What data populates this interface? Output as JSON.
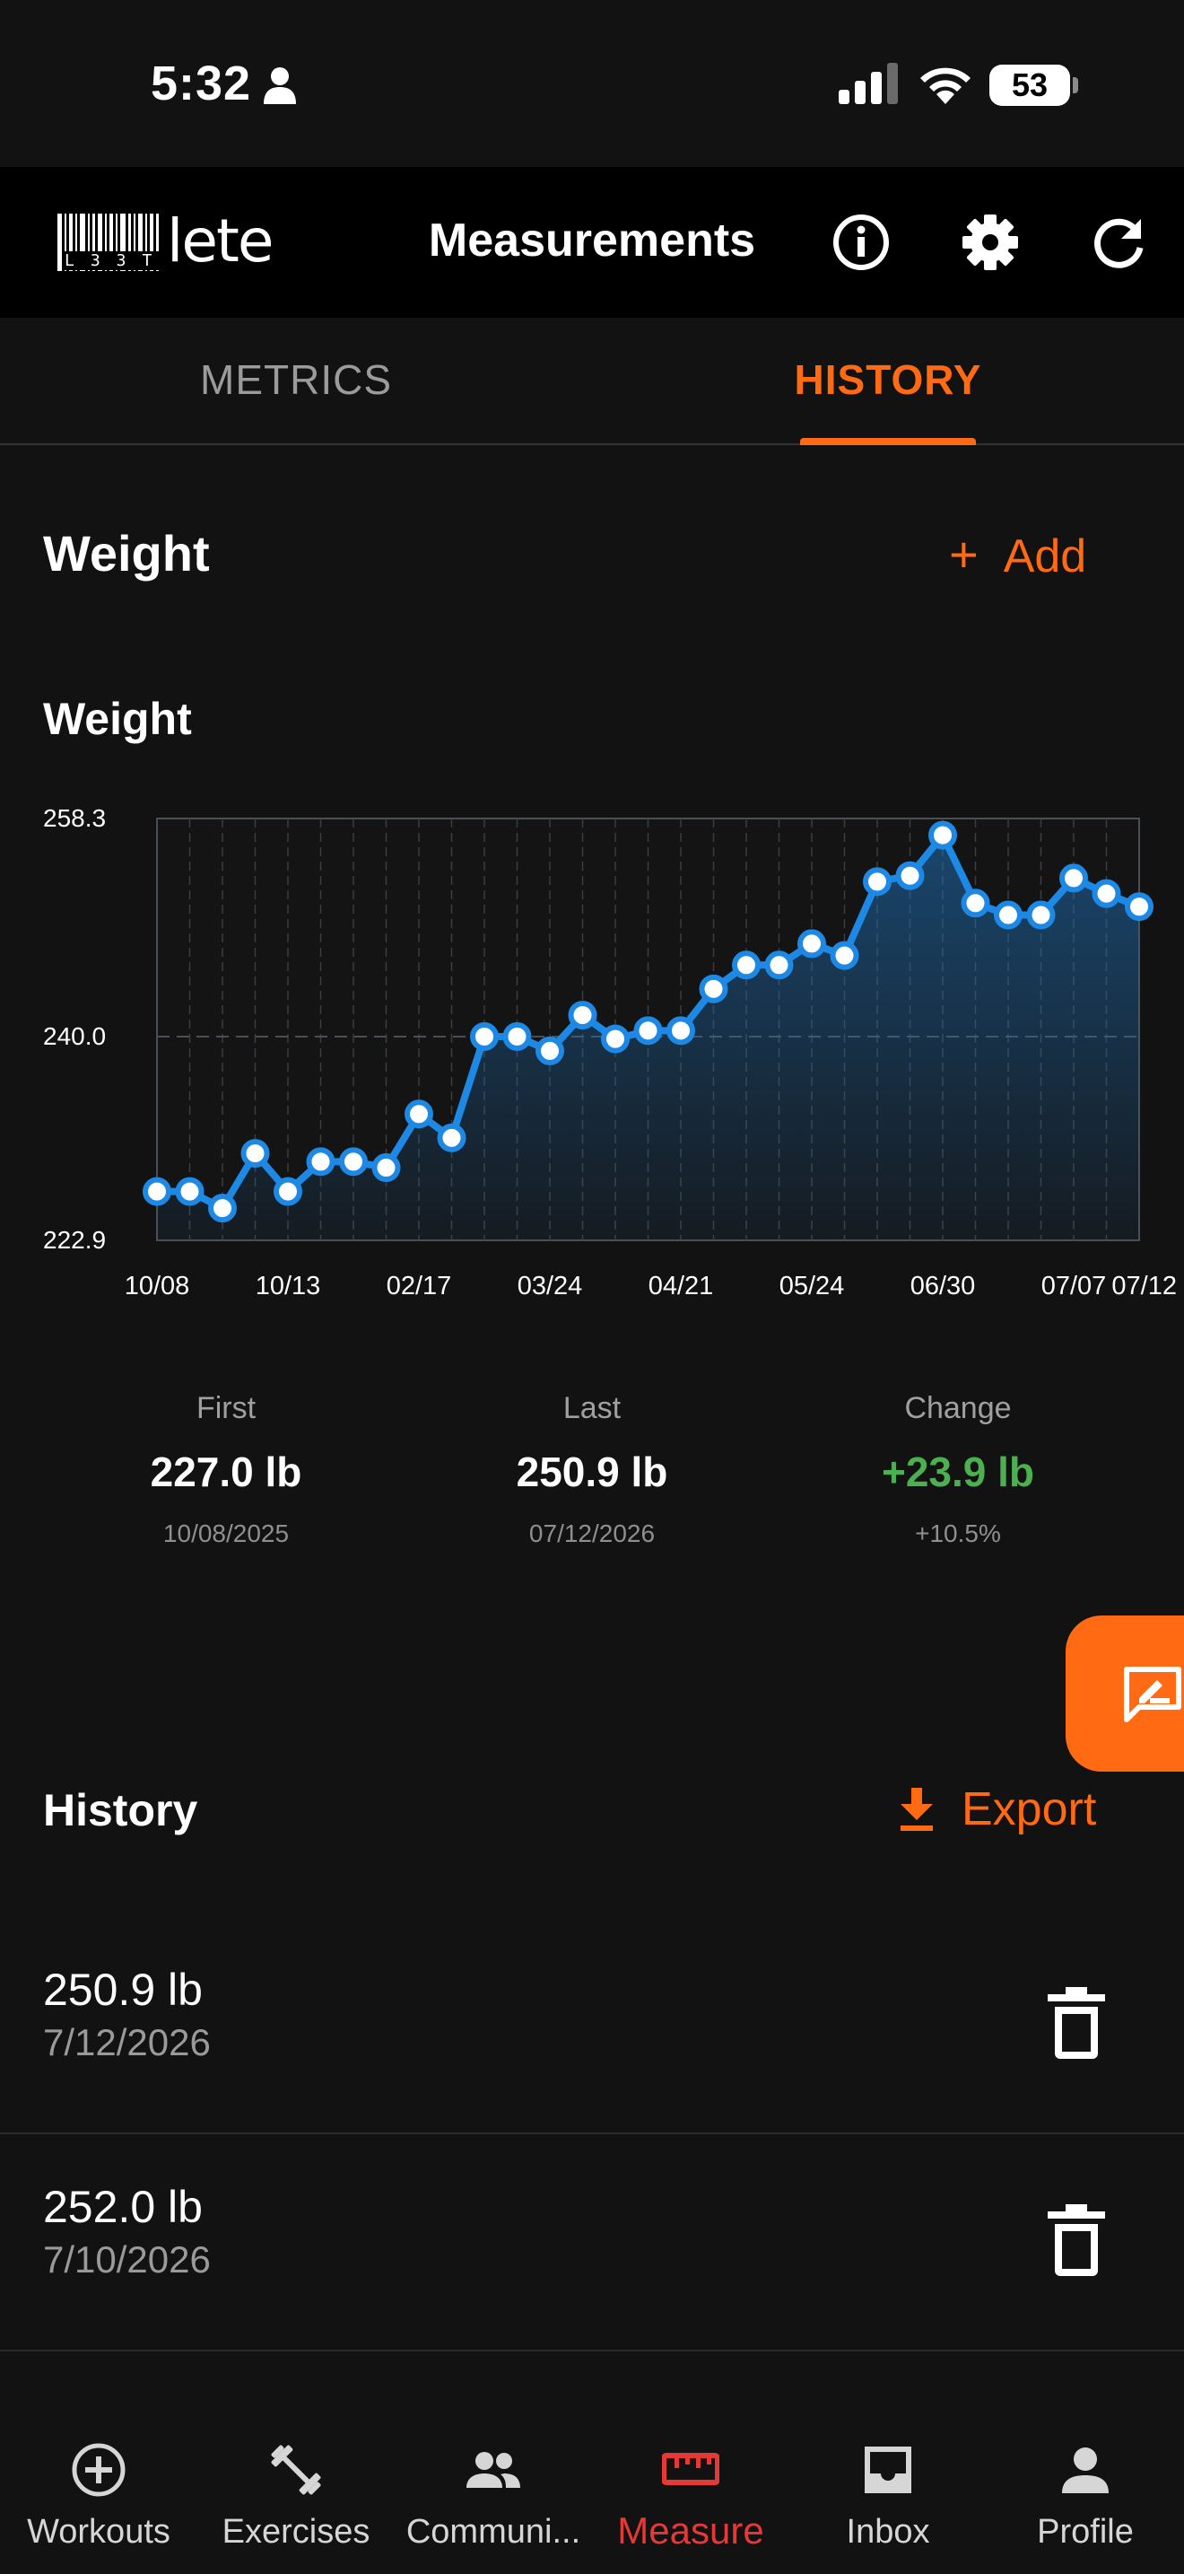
{
  "status_bar": {
    "time": "5:32",
    "battery": "53"
  },
  "app_bar": {
    "logo_text": "lete",
    "logo_sub": "L33T",
    "title": "Measurements"
  },
  "tabs": [
    {
      "label": "METRICS",
      "selected": false
    },
    {
      "label": "HISTORY",
      "selected": true
    }
  ],
  "section": {
    "title": "Weight",
    "add_label": "Add"
  },
  "chart_title": "Weight",
  "chart_data": {
    "type": "line",
    "title": "Weight",
    "y_ticks": [
      "258.3",
      "240.0",
      "222.9"
    ],
    "ylim": [
      222.9,
      258.3
    ],
    "x_tick_labels": [
      "10/08",
      "10/13",
      "02/17",
      "03/24",
      "04/21",
      "05/24",
      "06/30",
      "07/07",
      "07/12"
    ],
    "grid": true,
    "series": [
      {
        "values": [
          227.0,
          227.0,
          225.6,
          230.2,
          227.0,
          229.5,
          229.5,
          229.0,
          233.5,
          231.5,
          240.0,
          240.0,
          238.8,
          241.8,
          239.8,
          240.5,
          240.5,
          244.0,
          246.0,
          246.0,
          247.8,
          246.8,
          253.0,
          253.5,
          256.9,
          251.2,
          250.2,
          250.2,
          253.3,
          252.0,
          250.9
        ]
      }
    ]
  },
  "stats": {
    "first": {
      "label": "First",
      "value": "227.0 lb",
      "date": "10/08/2025"
    },
    "last": {
      "label": "Last",
      "value": "250.9 lb",
      "date": "07/12/2026"
    },
    "change": {
      "label": "Change",
      "value": "+23.9 lb",
      "percent": "+10.5%"
    }
  },
  "history": {
    "title": "History",
    "export_label": "Export",
    "entries": [
      {
        "weight": "250.9 lb",
        "date": "7/12/2026"
      },
      {
        "weight": "252.0 lb",
        "date": "7/10/2026"
      }
    ]
  },
  "bottom_nav": [
    {
      "label": "Workouts",
      "icon": "plus-circle-icon"
    },
    {
      "label": "Exercises",
      "icon": "dumbbell-icon"
    },
    {
      "label": "Communi...",
      "icon": "people-icon"
    },
    {
      "label": "Measure",
      "icon": "ruler-icon",
      "active": true
    },
    {
      "label": "Inbox",
      "icon": "inbox-icon"
    },
    {
      "label": "Profile",
      "icon": "person-icon"
    }
  ],
  "colors": {
    "accent": "#ff6a13",
    "line": "#1e88e5",
    "positive": "#4caf50",
    "nav_active": "#e53935"
  }
}
